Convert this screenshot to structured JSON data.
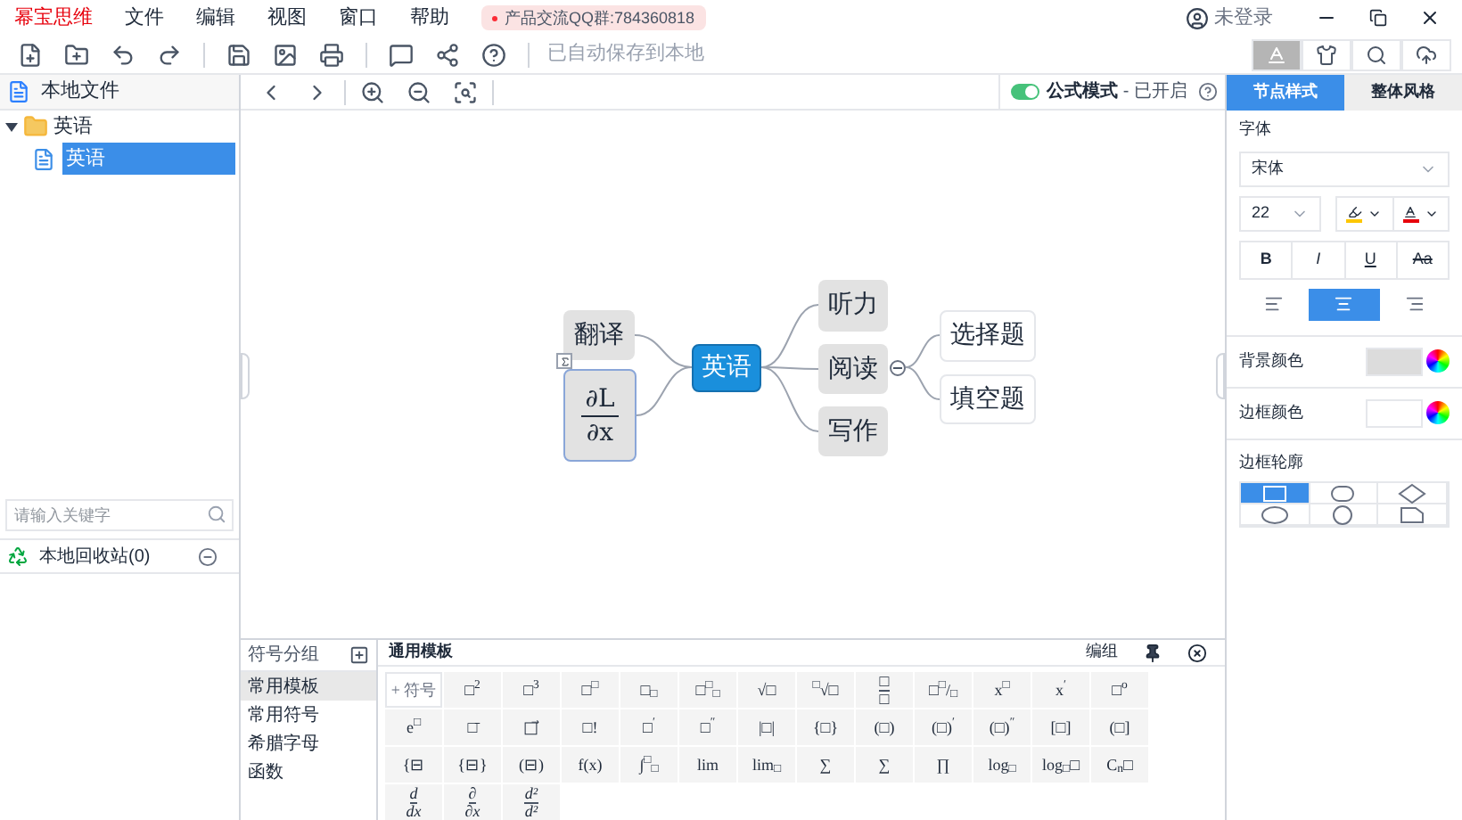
{
  "app": {
    "brand": "幂宝思维",
    "menu": [
      "文件",
      "编辑",
      "视图",
      "窗口",
      "帮助"
    ],
    "badge": "产品交流QQ群:784360818",
    "user": "未登录"
  },
  "toolbar": {
    "save_status": "已自动保存到本地"
  },
  "right_tools": [
    {
      "kind": "text-style",
      "selected": true
    },
    {
      "kind": "theme",
      "selected": false
    },
    {
      "kind": "search",
      "selected": false
    },
    {
      "kind": "cloud",
      "selected": false
    }
  ],
  "sidebar": {
    "title": "本地文件",
    "tree": [
      {
        "label": "英语",
        "kind": "folder",
        "expanded": true,
        "selected": false,
        "children": [
          {
            "label": "英语",
            "kind": "file",
            "selected": true
          }
        ]
      }
    ],
    "search": {
      "placeholder": "请输入关键字"
    },
    "recycle": "本地回收站(0)"
  },
  "formula_mode": {
    "on": true,
    "label": "公式模式",
    "status": "- 已开启"
  },
  "mindmap": {
    "root": "英语",
    "left": [
      {
        "kind": "text",
        "label": "翻译",
        "selected": false
      },
      {
        "kind": "formula",
        "num": "∂L",
        "den": "∂x",
        "selected": true
      }
    ],
    "right": [
      {
        "label": "听力"
      },
      {
        "label": "阅读",
        "expanded": true,
        "children": [
          {
            "label": "选择题"
          },
          {
            "label": "填空题"
          }
        ]
      },
      {
        "label": "写作"
      }
    ]
  },
  "style_panel": {
    "tabs": [
      {
        "label": "节点样式",
        "selected": true
      },
      {
        "label": "整体风格",
        "selected": false
      }
    ],
    "font_label": "字体",
    "font": "宋体",
    "size": "22",
    "format": [
      {
        "kind": "bold",
        "label": "B"
      },
      {
        "kind": "italic",
        "label": "I"
      },
      {
        "kind": "underline",
        "label": "U"
      },
      {
        "kind": "strike",
        "label": "Aa"
      }
    ],
    "align": [
      {
        "kind": "left",
        "selected": false
      },
      {
        "kind": "center",
        "selected": true
      },
      {
        "kind": "right",
        "selected": false
      }
    ],
    "bg_label": "背景颜色",
    "border_label": "边框颜色",
    "outline_label": "边框轮廓",
    "outlines": [
      {
        "kind": "rect",
        "selected": true
      },
      {
        "kind": "rounded",
        "selected": false
      },
      {
        "kind": "diamond",
        "selected": false
      },
      {
        "kind": "ellipse",
        "selected": false
      },
      {
        "kind": "circle",
        "selected": false
      },
      {
        "kind": "tab",
        "selected": false
      }
    ]
  },
  "symbols": {
    "title": "符号分组",
    "groups": [
      {
        "label": "常用模板",
        "selected": true
      },
      {
        "label": "常用符号",
        "selected": false
      },
      {
        "label": "希腊字母",
        "selected": false
      },
      {
        "label": "函数",
        "selected": false
      }
    ],
    "panel_title": "通用模板",
    "group_button": "编组",
    "templates": [
      [
        {
          "kind": "add",
          "text": "+ 符号"
        },
        {
          "kind": "math",
          "text": "□$^{2}$"
        },
        {
          "kind": "math",
          "text": "□$^{3}$"
        },
        {
          "kind": "math",
          "text": "□$^{□}$"
        },
        {
          "kind": "math",
          "text": "□$_{□}$"
        },
        {
          "kind": "math",
          "text": "□$^{□}$$_{□}$"
        },
        {
          "kind": "math",
          "text": "√□"
        },
        {
          "kind": "math",
          "text": "$^{□}$√□"
        },
        {
          "kind": "frac",
          "num": "□",
          "den": "□"
        },
        {
          "kind": "math",
          "text": "□$^{□}$/$_{□}$"
        },
        {
          "kind": "math",
          "text": "x$^{□}$"
        },
        {
          "kind": "math",
          "text": "x$^{′}$"
        },
        {
          "kind": "math",
          "text": "□$^{o}$"
        }
      ],
      [
        {
          "kind": "math",
          "text": "e$^{□}$"
        },
        {
          "kind": "math",
          "text": "□̄"
        },
        {
          "kind": "math",
          "text": "□⃗"
        },
        {
          "kind": "math",
          "text": "□!"
        },
        {
          "kind": "math",
          "text": "□$^{′}$"
        },
        {
          "kind": "math",
          "text": "□$^{″}$"
        },
        {
          "kind": "math",
          "text": "|□|"
        },
        {
          "kind": "math",
          "text": "{□}"
        },
        {
          "kind": "math",
          "text": "(□)"
        },
        {
          "kind": "math",
          "text": "(□)$^{′}$"
        },
        {
          "kind": "math",
          "text": "(□)$^{″}$"
        },
        {
          "kind": "math",
          "text": "[□]"
        },
        {
          "kind": "math",
          "text": "(□]"
        }
      ],
      [
        {
          "kind": "math",
          "text": "{⊟"
        },
        {
          "kind": "math",
          "text": "{⊟}"
        },
        {
          "kind": "math",
          "text": "(⊟)"
        },
        {
          "kind": "math",
          "text": "f(x)"
        },
        {
          "kind": "math",
          "text": "∫$^{□}$$_{□}$"
        },
        {
          "kind": "math",
          "text": "lim"
        },
        {
          "kind": "math",
          "text": "lim$_{□}$"
        },
        {
          "kind": "math",
          "text": "∑"
        },
        {
          "kind": "math",
          "text": "∑"
        },
        {
          "kind": "math",
          "text": "∏"
        },
        {
          "kind": "math",
          "text": "log$_{□}$"
        },
        {
          "kind": "math",
          "text": "log$_{□}$□"
        },
        {
          "kind": "math",
          "text": "C$_{n}$□"
        }
      ],
      [
        {
          "kind": "frac",
          "num": "d",
          "den": "dx"
        },
        {
          "kind": "frac",
          "num": "∂",
          "den": "∂x"
        },
        {
          "kind": "frac",
          "num": "d²",
          "den": "d²"
        }
      ]
    ]
  }
}
